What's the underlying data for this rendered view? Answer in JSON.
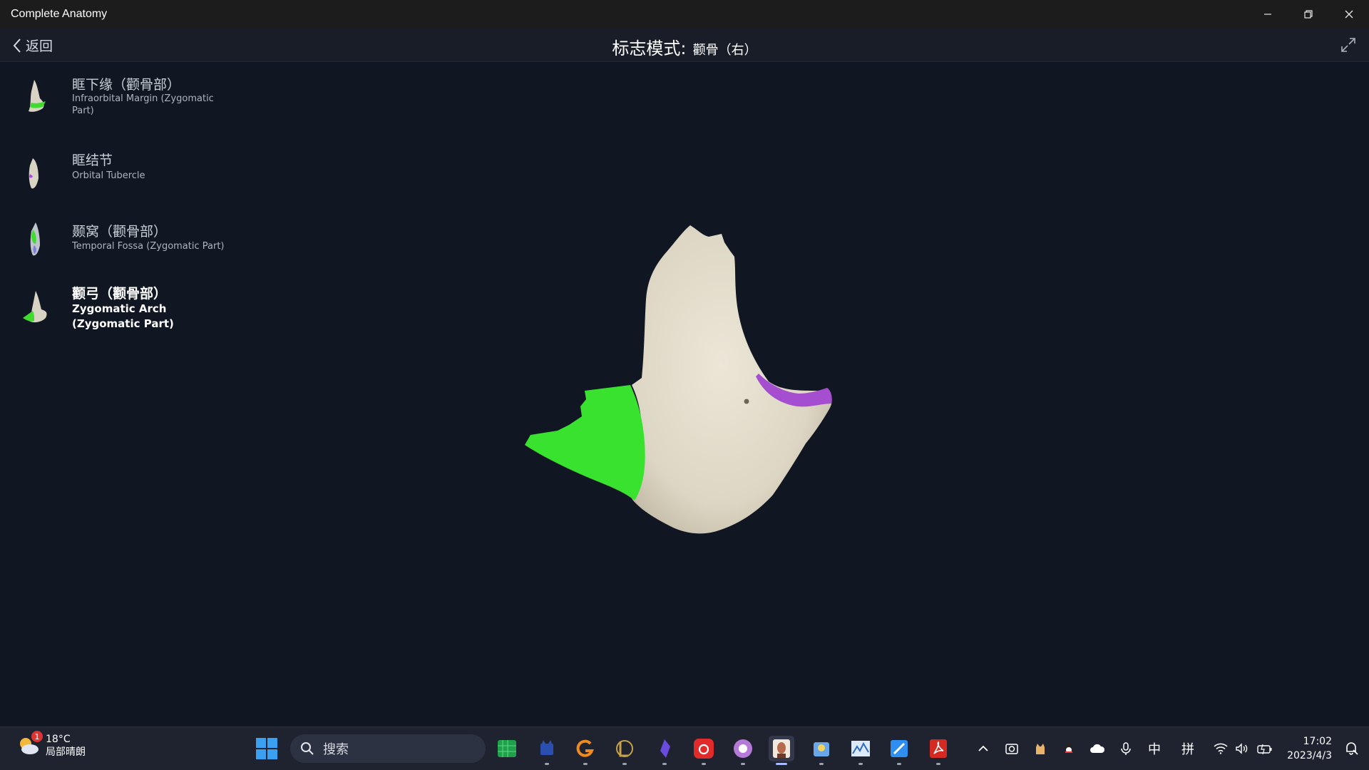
{
  "window": {
    "title": "Complete Anatomy"
  },
  "header": {
    "back_label": "返回",
    "mode_label": "标志模式:",
    "bone_label": "颧骨（右）"
  },
  "landmarks": [
    {
      "zh": "眶下缘（颧骨部）",
      "en": "Infraorbital Margin (Zygomatic Part)",
      "active": false
    },
    {
      "zh": "眶结节",
      "en": "Orbital Tubercle",
      "active": false
    },
    {
      "zh": "颞窝（颧骨部）",
      "en": "Temporal Fossa (Zygomatic Part)",
      "active": false
    },
    {
      "zh": "颧弓（颧骨部）",
      "en": "Zygomatic Arch (Zygomatic Part)",
      "active": true
    }
  ],
  "colors": {
    "background": "#111722",
    "highlight_green": "#39e22f",
    "highlight_purple": "#a54fd0",
    "bone": "#e3ddcd"
  },
  "taskbar": {
    "weather_badge": "1",
    "temperature": "18°C",
    "condition": "局部晴朗",
    "search_placeholder": "搜索",
    "apps": [
      "spreadsheet-app",
      "cat-app",
      "grammar-app",
      "league-app",
      "crystal-app",
      "netease-music-app",
      "chat-app",
      "complete-anatomy-app",
      "photo-app",
      "graph-app",
      "paint-app",
      "pdf-app"
    ],
    "tray_ime_lang": "中",
    "tray_ime_mode": "拼",
    "time": "17:02",
    "date": "2023/4/3"
  }
}
